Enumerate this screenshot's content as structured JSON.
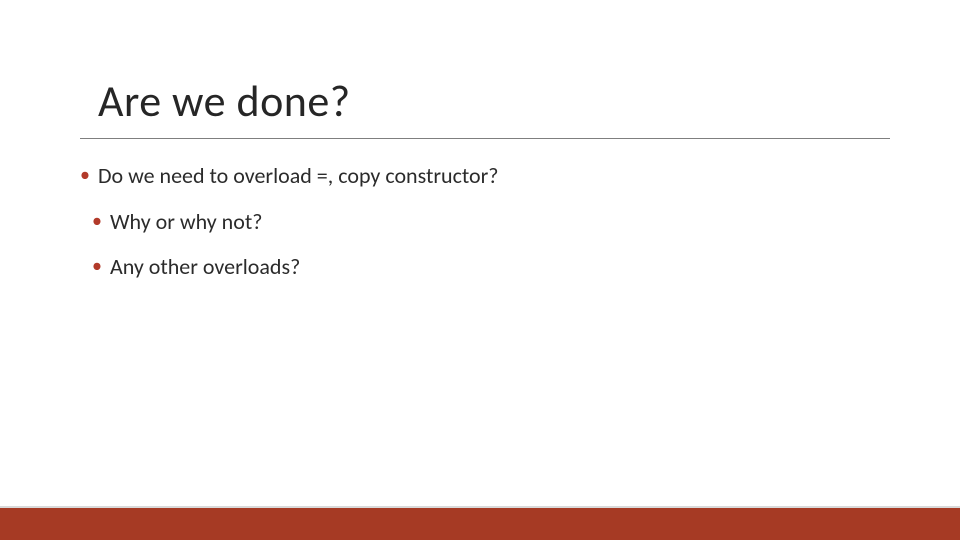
{
  "slide": {
    "title": "Are we done?",
    "bullets": [
      {
        "text": "Do we need to overload =, copy constructor?",
        "indent": false
      },
      {
        "text": "Why or why not?",
        "indent": true
      },
      {
        "text": "Any other overloads?",
        "indent": true
      }
    ]
  },
  "theme": {
    "accent": "#a63a24",
    "bullet_color": "#b23a2a"
  }
}
